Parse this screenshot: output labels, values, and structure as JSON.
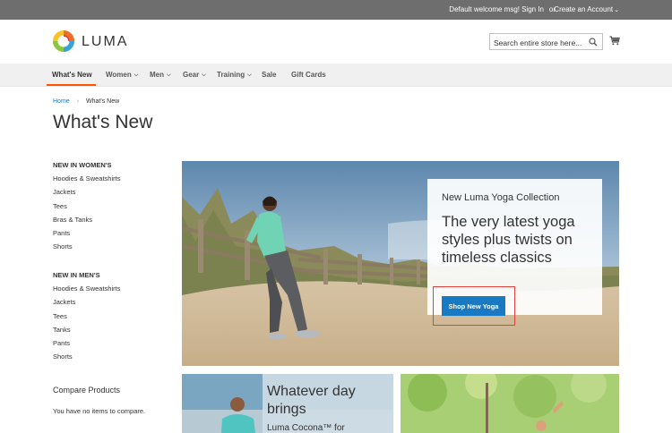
{
  "topbar": {
    "welcome": "Default welcome msg!",
    "signin": "Sign In",
    "or": "or",
    "create_account": "Create an Account"
  },
  "header": {
    "logo_text": "LUMA",
    "search_placeholder": "Search entire store here..."
  },
  "nav": {
    "items": [
      {
        "label": "What's New",
        "active": true
      },
      {
        "label": "Women",
        "dropdown": true
      },
      {
        "label": "Men",
        "dropdown": true
      },
      {
        "label": "Gear",
        "dropdown": true
      },
      {
        "label": "Training",
        "dropdown": true
      },
      {
        "label": "Sale"
      },
      {
        "label": "Gift Cards"
      }
    ]
  },
  "breadcrumb": {
    "home": "Home",
    "current": "What's New"
  },
  "page_title": "What's New",
  "sidebar": {
    "women_heading": "NEW IN WOMEN'S",
    "women_links": [
      "Hoodies & Sweatshirts",
      "Jackets",
      "Tees",
      "Bras & Tanks",
      "Pants",
      "Shorts"
    ],
    "men_heading": "NEW IN MEN'S",
    "men_links": [
      "Hoodies & Sweatshirts",
      "Jackets",
      "Tees",
      "Tanks",
      "Pants",
      "Shorts"
    ],
    "compare_title": "Compare Products",
    "compare_empty": "You have no items to compare."
  },
  "hero": {
    "subtitle": "New Luma Yoga Collection",
    "headline": "The very latest yoga styles plus twists on timeless classics",
    "button": "Shop New Yoga"
  },
  "tile1": {
    "headline": "Whatever day brings",
    "subtext": "Luma Cocona™ for"
  },
  "colors": {
    "topbar_bg": "#6e6e6e",
    "nav_active_underline": "#ff5501",
    "primary_button": "#1979c3",
    "link_blue": "#1979c3",
    "highlight_frame": "#e0423f"
  }
}
